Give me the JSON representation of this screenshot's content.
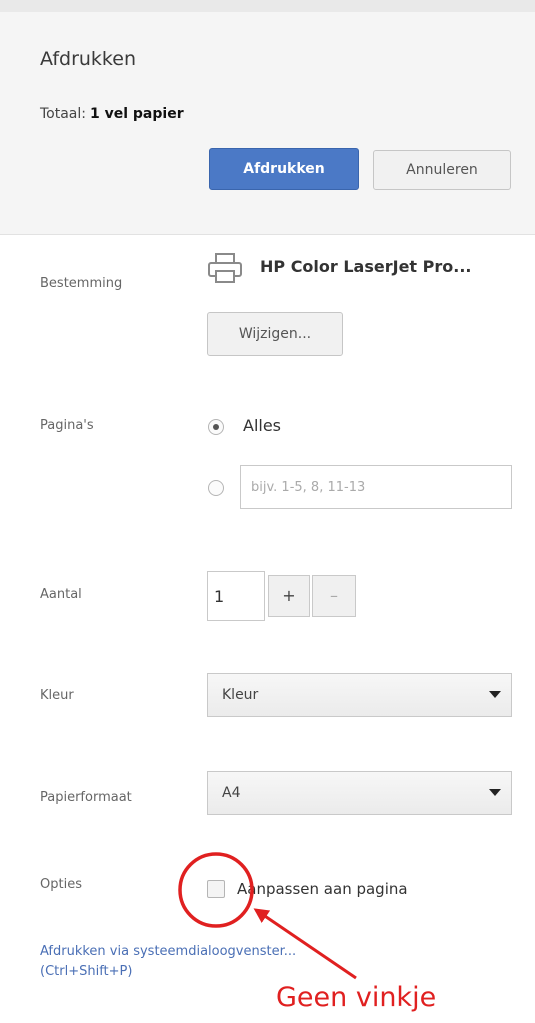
{
  "dialog": {
    "title": "Afdrukken",
    "total_label": "Totaal:",
    "total_value": "1 vel papier",
    "print_button": "Afdrukken",
    "cancel_button": "Annuleren"
  },
  "destination": {
    "label": "Bestemming",
    "printer_name": "HP Color LaserJet Pro...",
    "change_button": "Wijzigen..."
  },
  "pages": {
    "label": "Pagina's",
    "all_option": "Alles",
    "custom_placeholder": "bijv. 1-5, 8, 11-13"
  },
  "copies": {
    "label": "Aantal",
    "value": "1",
    "plus": "+",
    "minus": "–"
  },
  "color": {
    "label": "Kleur",
    "selected": "Kleur"
  },
  "paper_size": {
    "label": "Papierformaat",
    "selected": "A4"
  },
  "options": {
    "label": "Opties",
    "fit_to_page": "Aanpassen aan pagina",
    "fit_to_page_checked": false
  },
  "system_dialog_link": {
    "text": "Afdrukken via systeemdialoogvenster...",
    "shortcut": "(Ctrl+Shift+P)"
  },
  "annotation": {
    "text": "Geen vinkje",
    "color": "#e02020"
  },
  "colors": {
    "primary_button": "#4b79c6",
    "link": "#4a6fb5",
    "header_bg": "#f5f5f5"
  }
}
